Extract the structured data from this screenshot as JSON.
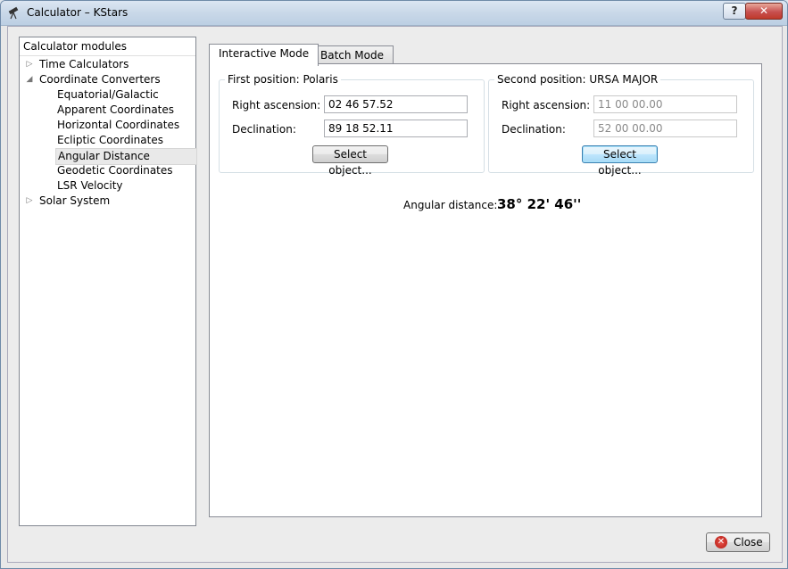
{
  "window": {
    "title": "Calculator – KStars",
    "help_label": "?",
    "close_label": "✕"
  },
  "sidebar": {
    "header": "Calculator modules",
    "items": [
      {
        "label": "Time Calculators",
        "expander": "▷"
      },
      {
        "label": "Coordinate Converters",
        "expander": "◢"
      },
      {
        "label": "Equatorial/Galactic"
      },
      {
        "label": "Apparent Coordinates"
      },
      {
        "label": "Horizontal Coordinates"
      },
      {
        "label": "Ecliptic Coordinates"
      },
      {
        "label": "Angular Distance",
        "selected": true
      },
      {
        "label": "Geodetic Coordinates"
      },
      {
        "label": "LSR Velocity"
      },
      {
        "label": "Solar System",
        "expander": "▷"
      }
    ]
  },
  "tabs": [
    {
      "label": "Interactive Mode",
      "active": true
    },
    {
      "label": "Batch Mode",
      "active": false
    }
  ],
  "first_position": {
    "title": "First position: Polaris",
    "ra_label": "Right ascension:",
    "ra_value": "02 46 57.52",
    "dec_label": "Declination:",
    "dec_value": "89 18 52.11",
    "select_label": "Select object..."
  },
  "second_position": {
    "title": "Second position: URSA MAJOR",
    "ra_label": "Right ascension:",
    "ra_value": "11 00 00.00",
    "dec_label": "Declination:",
    "dec_value": "52 00 00.00",
    "select_label": "Select object..."
  },
  "result": {
    "label": "Angular distance:",
    "value": "38° 22' 46''"
  },
  "footer": {
    "close_label": "Close",
    "close_icon": "✕"
  }
}
